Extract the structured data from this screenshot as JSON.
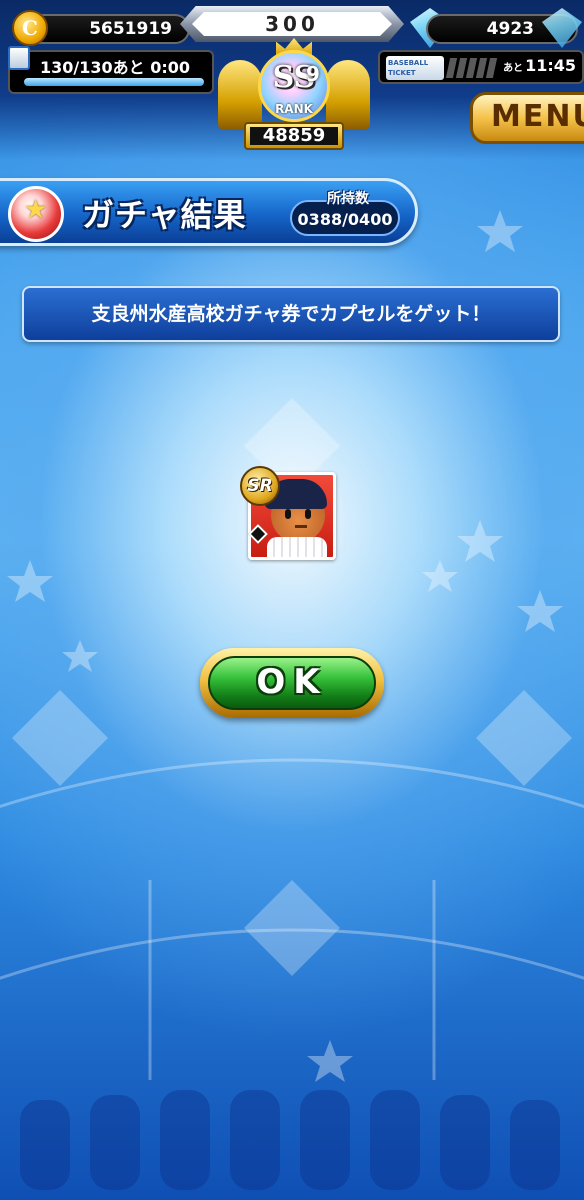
{
  "header": {
    "coins": "5651919",
    "stamina_value": "300",
    "gems": "4923",
    "life": "130/130あと 0:00",
    "life_fill": 1.0,
    "ticket_remaining_prefix": "あと",
    "ticket_time": "11:45",
    "ticket_icon_text": "BASEBALL TICKET",
    "rank": {
      "grade": "SS",
      "level": "9",
      "word": "RANK",
      "score": "48859"
    },
    "menu_label": "MENU"
  },
  "title": {
    "text": "ガチャ結果",
    "owned_label": "所持数",
    "owned_value": "0388/0400"
  },
  "message": "支良州水産高校ガチャ券でカプセルをゲット！",
  "card": {
    "rarity": "SR"
  },
  "ok_label": "OK",
  "colors": {
    "background": "#4aa6ee",
    "banner": "#1565c8",
    "ok_green": "#36c03a",
    "card_red": "#e0301e"
  }
}
